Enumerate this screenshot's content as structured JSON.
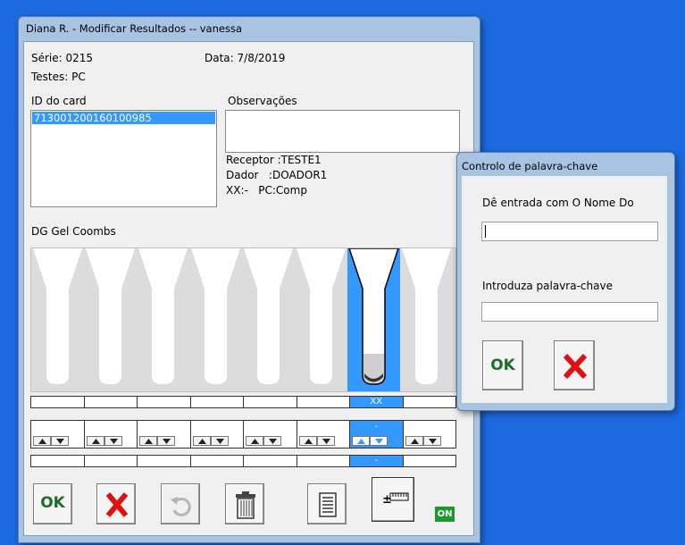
{
  "main_window": {
    "title": "Diana R. - Modificar Resultados -- vanessa",
    "serie_label": "Série: 0215",
    "data_label": "Data: 7/8/2019",
    "testes_label": "Testes: PC",
    "id_card_label": "ID do card",
    "id_card_items": [
      "713001200160100985"
    ],
    "observacoes_label": "Observações",
    "observacoes_value": "",
    "receptor": "Receptor :TESTE1",
    "dador": "Dador   :DOADOR1",
    "xx_line": "XX:-   PC:Comp",
    "card_type": "DG Gel Coombs",
    "result_row_selected_text": "XX",
    "secondary_row_selected_text": "-",
    "selected_column": 7,
    "columns": 8
  },
  "toolbar": {
    "ok_label": "OK",
    "on_badge": "ON"
  },
  "dialog": {
    "title": "Controlo de palavra-chave",
    "name_prompt": "Dê entrada com O Nome Do",
    "name_value": "",
    "password_prompt": "Introduza palavra-chave",
    "password_value": "",
    "ok_label": "OK"
  },
  "colors": {
    "desktop": "#1d6ae0",
    "selection": "#3399ff",
    "ok_green": "#1e6e2a",
    "cancel_red": "#e01010"
  },
  "icons": [
    "cancel-x-icon",
    "undo-icon",
    "trash-icon",
    "report-icon",
    "plus-minus-ruler-icon"
  ]
}
